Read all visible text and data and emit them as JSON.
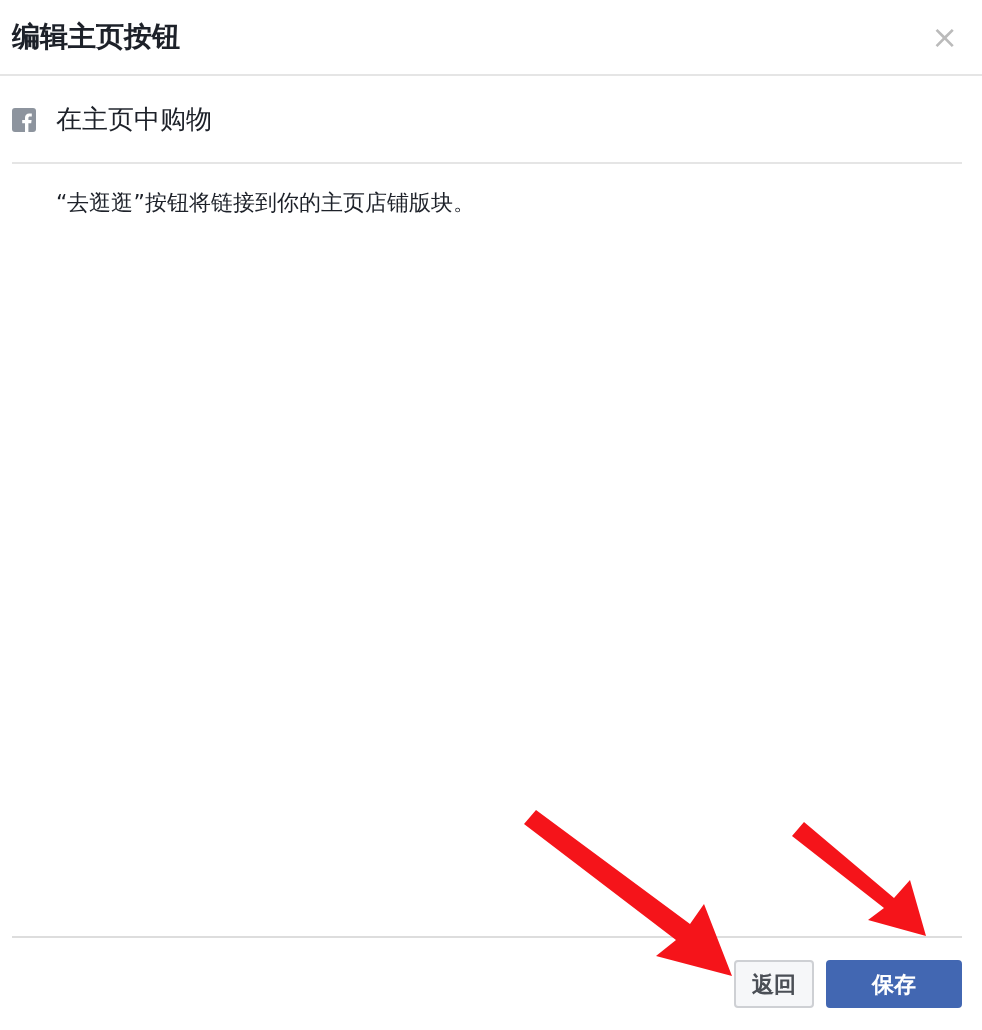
{
  "dialog": {
    "title": "编辑主页按钮",
    "close": "×"
  },
  "option": {
    "label": "在主页中购物"
  },
  "description": "“去逛逛”按钮将链接到你的主页店铺版块。",
  "buttons": [
    {
      "label": "返回",
      "kind": "secondary"
    },
    {
      "label": "保存",
      "kind": "primary"
    }
  ]
}
